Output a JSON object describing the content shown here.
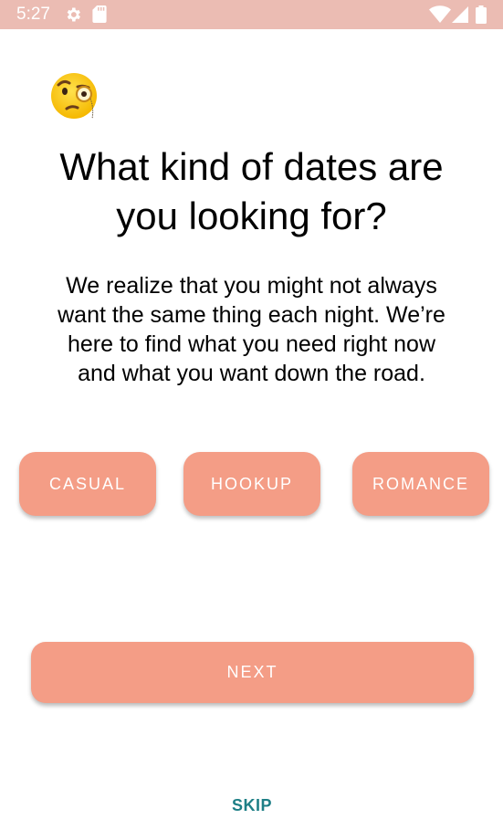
{
  "status_bar": {
    "time": "5:27",
    "icons": [
      "gear-icon",
      "sd-card-icon",
      "wifi-icon",
      "signal-icon",
      "battery-icon"
    ],
    "background": "#ebbcb3"
  },
  "emoji": "face-with-monocle-icon",
  "title": "What kind of dates are you looking for?",
  "subtitle": "We realize that you might not always want the same thing each night. We’re here to find what you need right now and what you want down the road.",
  "options": [
    {
      "label": "CASUAL"
    },
    {
      "label": "HOOKUP"
    },
    {
      "label": "ROMANCE"
    }
  ],
  "next_label": "NEXT",
  "skip_label": "SKIP",
  "colors": {
    "accent": "#f49d86",
    "link": "#1e7f86"
  }
}
